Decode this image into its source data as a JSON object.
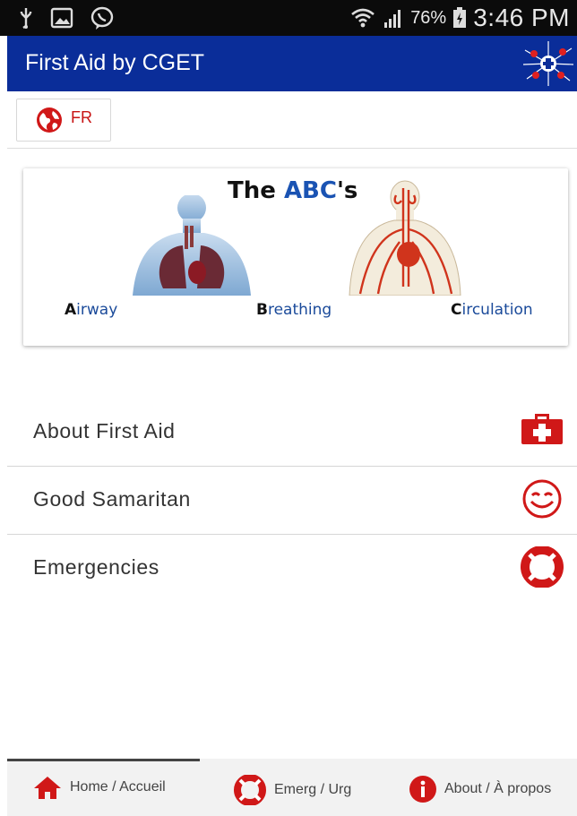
{
  "status_bar": {
    "battery_percent": "76%",
    "time": "3:46 PM",
    "icons": [
      "usb-icon",
      "image-icon",
      "viber-icon",
      "wifi-icon",
      "signal-icon",
      "battery-icon"
    ]
  },
  "app_bar": {
    "title": "First Aid by CGET",
    "logo": "cget-logo-icon"
  },
  "language": {
    "button_label": "FR",
    "icon": "globe-icon"
  },
  "abc_card": {
    "title_prefix": "The ",
    "title_highlight": "ABC",
    "title_suffix": "'s",
    "captions": [
      {
        "initial": "A",
        "rest": "irway"
      },
      {
        "initial": "B",
        "rest": "reathing"
      },
      {
        "initial": "C",
        "rest": "irculation"
      }
    ]
  },
  "menu": {
    "items": [
      {
        "label": "About First Aid",
        "icon": "first-aid-kit-icon"
      },
      {
        "label": "Good Samaritan",
        "icon": "smiley-icon"
      },
      {
        "label": "Emergencies",
        "icon": "lifebuoy-icon"
      }
    ]
  },
  "bottom_nav": {
    "items": [
      {
        "label": "Home / Accueil",
        "icon": "home-icon",
        "active": true
      },
      {
        "label": "Emerg / Urg",
        "icon": "lifebuoy-icon",
        "active": false
      },
      {
        "label": "About / À propos",
        "icon": "info-icon",
        "active": false
      }
    ]
  },
  "colors": {
    "app_bar": "#0a2d99",
    "accent_red": "#d01818",
    "status_bar": "#0b0b0b"
  }
}
